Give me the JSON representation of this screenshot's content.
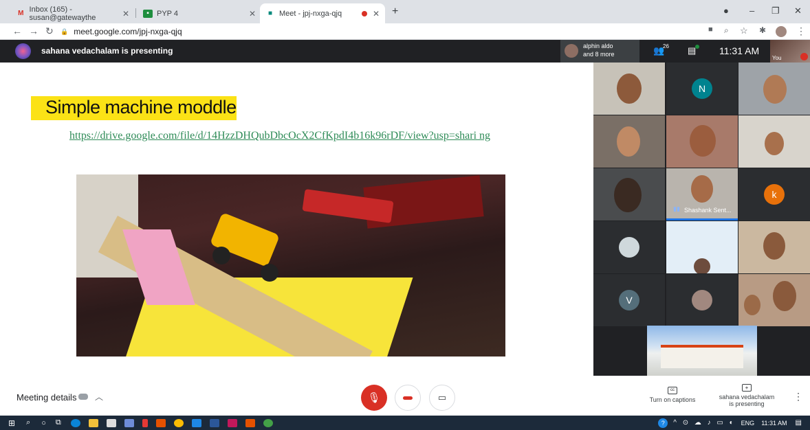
{
  "browser": {
    "tabs": [
      {
        "label": "Inbox (165) - susan@gatewaythe"
      },
      {
        "label": "PYP 4"
      },
      {
        "label": "Meet - jpj-nxga-qjq"
      }
    ],
    "url": "meet.google.com/jpj-nxga-qjq"
  },
  "meet": {
    "presenting_text": "sahana vedachalam is presenting",
    "tile_name_top": "alphin aldo",
    "tile_name_bottom": "and 8 more",
    "people_count": "26",
    "clock": "11:31 AM",
    "self_label": "You"
  },
  "slide": {
    "title": "Simple machine moddle",
    "link": "https://drive.google.com/file/d/14HzzDHQubDbcOcX2CfKpdI4b16k96rDF/view?usp=shari ng"
  },
  "participants": {
    "initial_n": "N",
    "initial_k": "k",
    "initial_v": "V",
    "speaking_name": "Shashank Sent..."
  },
  "controls": {
    "meeting_details": "Meeting details",
    "captions": "Turn on captions",
    "presenter_line1": "sahana vedachalam",
    "presenter_line2": "is presenting"
  },
  "taskbar": {
    "lang": "ENG",
    "time": "11:31 AM"
  },
  "colors": {
    "accent_red": "#d93025",
    "title_yellow": "#fbe216",
    "link_green": "#2e8b57",
    "avatar_teal": "#00838f",
    "avatar_orange": "#e8710a",
    "avatar_slate": "#546e7a"
  }
}
